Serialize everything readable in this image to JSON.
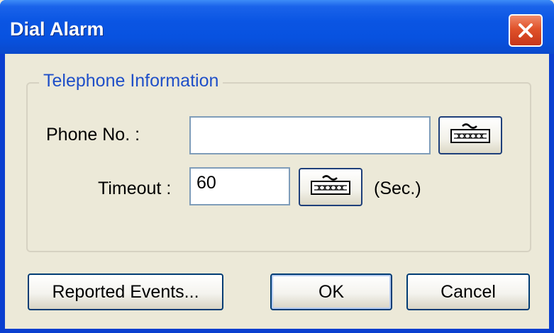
{
  "window": {
    "title": "Dial Alarm"
  },
  "group": {
    "label": "Telephone Information"
  },
  "phone": {
    "label": "Phone No. :",
    "value": ""
  },
  "timeout": {
    "label": "Timeout :",
    "value": "60",
    "unit": "(Sec.)"
  },
  "buttons": {
    "reported_events": "Reported Events...",
    "ok": "OK",
    "cancel": "Cancel"
  },
  "icons": {
    "close": "close-icon",
    "keyboard": "keyboard-icon"
  },
  "colors": {
    "titlebar": "#0a55e3",
    "close_button": "#e0522a",
    "dialog_background": "#ece9d8",
    "group_label": "#1f4fc8"
  }
}
